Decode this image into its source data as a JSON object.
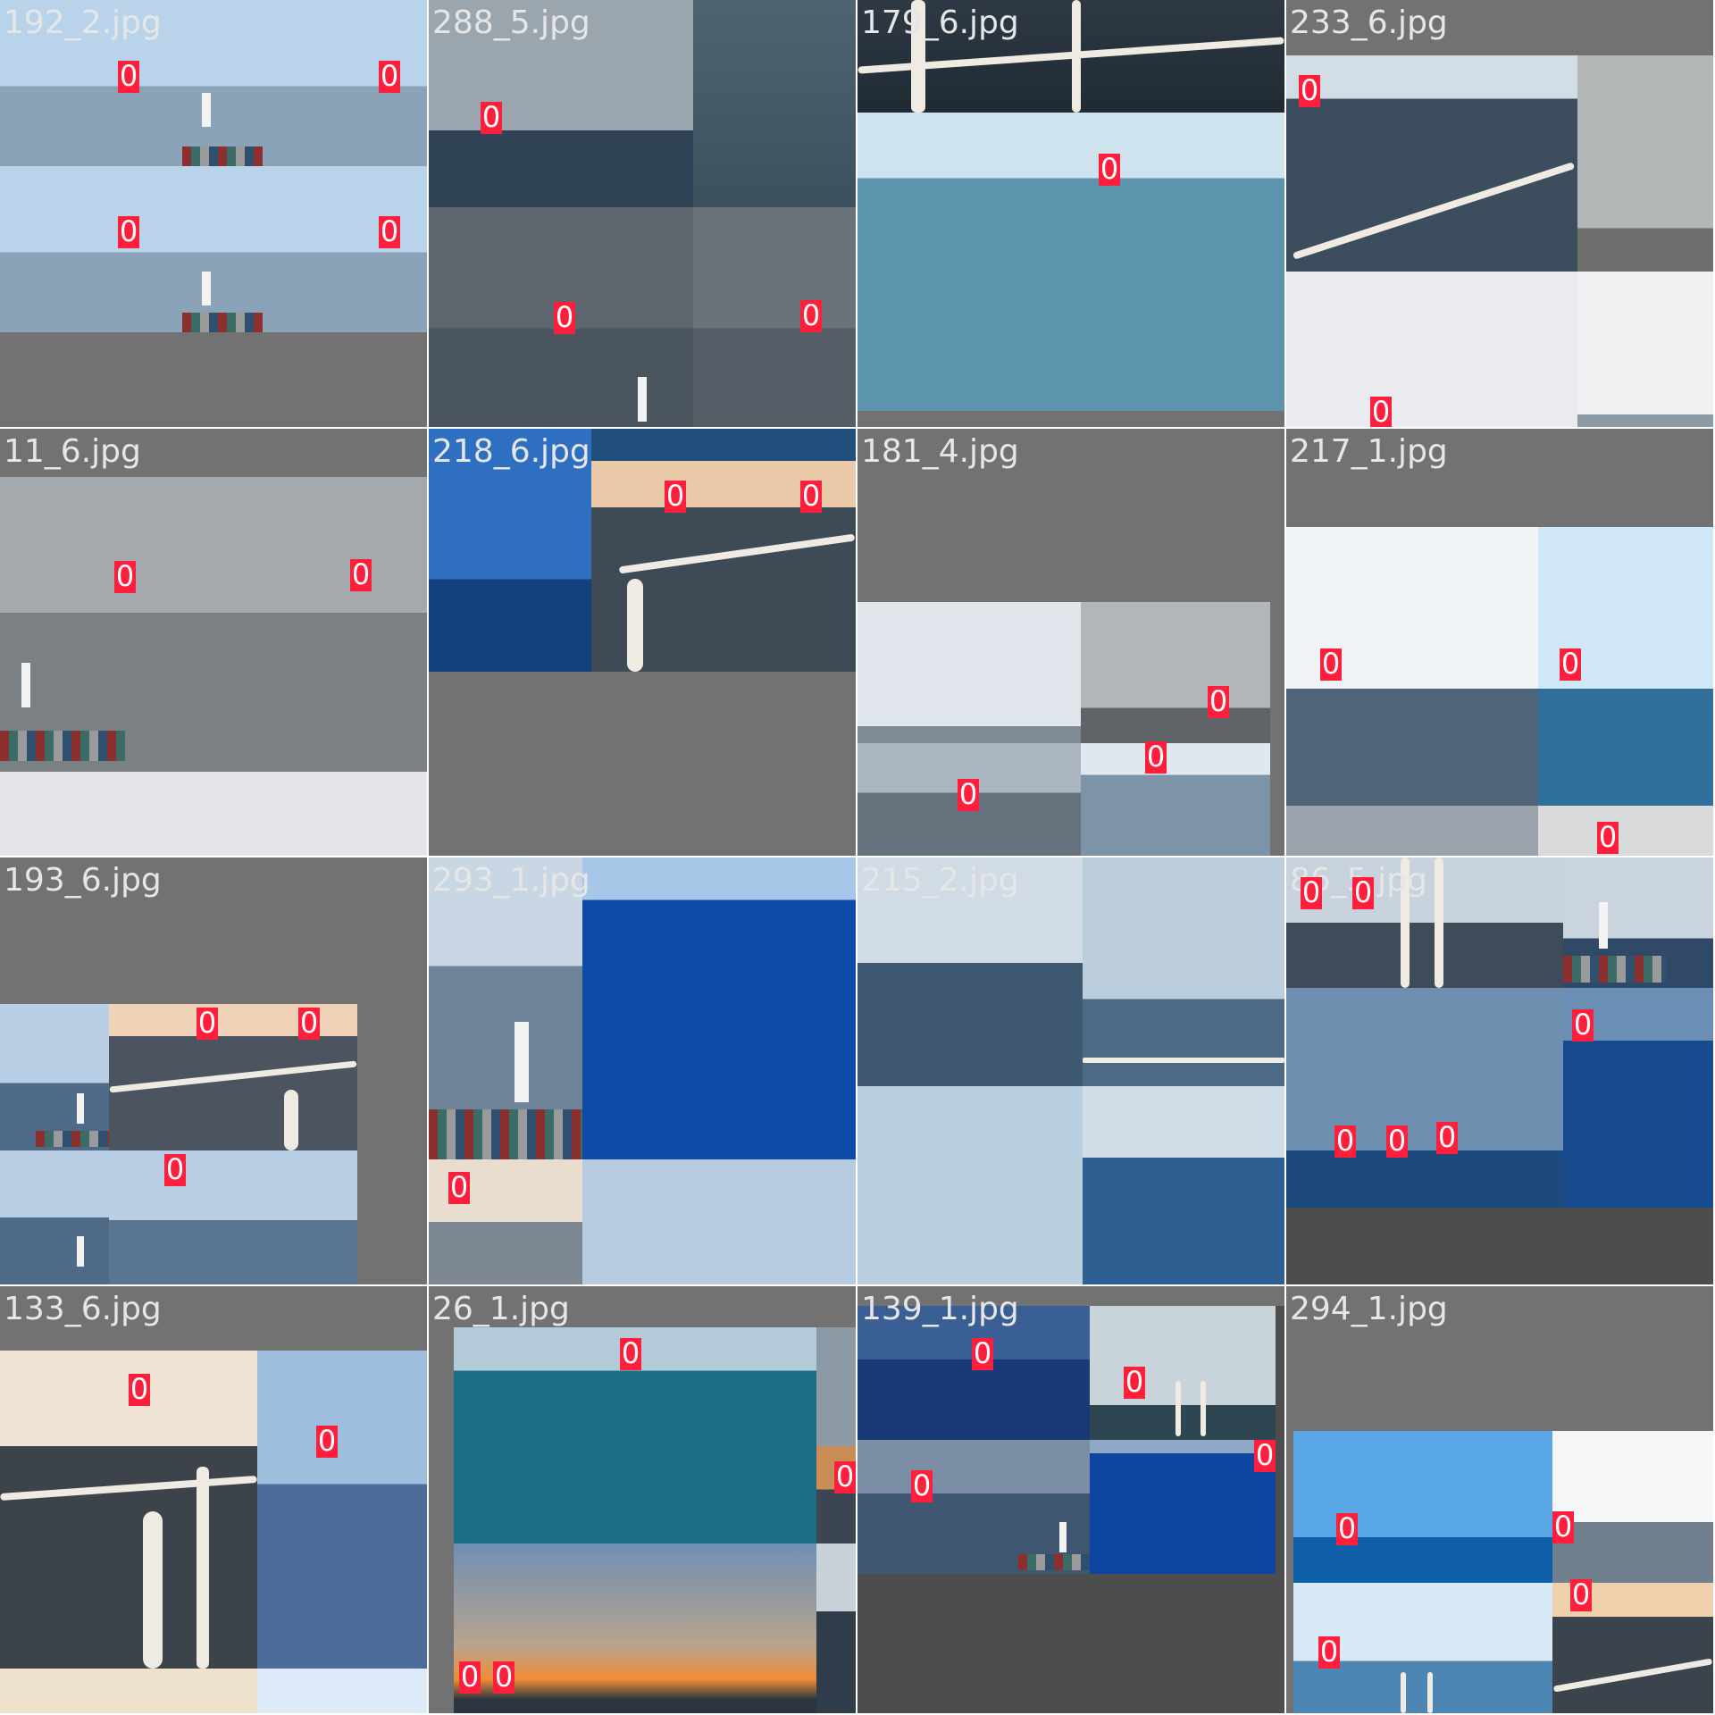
{
  "mosaic": {
    "tiles": [
      {
        "filename": "192_2.jpg",
        "labels": [
          "0",
          "0",
          "0",
          "0"
        ]
      },
      {
        "filename": "288_5.jpg",
        "labels": [
          "0",
          "0",
          "0"
        ]
      },
      {
        "filename": "179_6.jpg",
        "labels": [
          "0"
        ]
      },
      {
        "filename": "233_6.jpg",
        "labels": [
          "0",
          "0"
        ]
      },
      {
        "filename": "11_6.jpg",
        "labels": [
          "0",
          "0"
        ]
      },
      {
        "filename": "218_6.jpg",
        "labels": [
          "0",
          "0"
        ]
      },
      {
        "filename": "181_4.jpg",
        "labels": [
          "0",
          "0",
          "0"
        ]
      },
      {
        "filename": "217_1.jpg",
        "labels": [
          "0",
          "0",
          "0"
        ]
      },
      {
        "filename": "193_6.jpg",
        "labels": [
          "0",
          "0",
          "0"
        ]
      },
      {
        "filename": "293_1.jpg",
        "labels": [
          "0"
        ]
      },
      {
        "filename": "215_2.jpg",
        "labels": []
      },
      {
        "filename": "86_5.jpg",
        "labels": [
          "0",
          "0",
          "0",
          "0",
          "0",
          "0"
        ]
      },
      {
        "filename": "133_6.jpg",
        "labels": [
          "0",
          "0"
        ]
      },
      {
        "filename": "26_1.jpg",
        "labels": [
          "0",
          "0",
          "0",
          "0"
        ]
      },
      {
        "filename": "139_1.jpg",
        "labels": [
          "0",
          "0",
          "0",
          "0"
        ]
      },
      {
        "filename": "294_1.jpg",
        "labels": [
          "0",
          "0",
          "0",
          "0"
        ]
      }
    ]
  },
  "colors": {
    "label_bg": "#ff1f3d",
    "padding_gray": "#727272",
    "sky_light": "#cfe0ee",
    "sea_gray": "#6f7f8f",
    "sea_blue": "#1f5ea8"
  }
}
